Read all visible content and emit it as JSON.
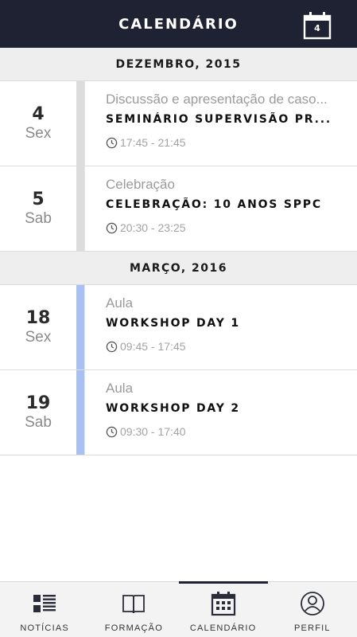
{
  "header": {
    "title": "CALENDÁRIO",
    "calendar_badge": "4"
  },
  "sections": [
    {
      "month": "DEZEMBRO, 2015",
      "events": [
        {
          "day": "4",
          "weekday": "Sex",
          "category": "Discussão e apresentação de caso...",
          "title": "SEMINÁRIO SUPERVISÃO PR...",
          "time": "17:45 - 21:45",
          "bar_color": "#dcdcdc"
        },
        {
          "day": "5",
          "weekday": "Sab",
          "category": "Celebração",
          "title": "CELEBRAÇÃO: 10 ANOS SPPC",
          "time": "20:30 - 23:25",
          "bar_color": "#dcdcdc"
        }
      ]
    },
    {
      "month": "MARÇO, 2016",
      "events": [
        {
          "day": "18",
          "weekday": "Sex",
          "category": "Aula",
          "title": "WORKSHOP DAY 1",
          "time": "09:45 - 17:45",
          "bar_color": "#a9c1f1"
        },
        {
          "day": "19",
          "weekday": "Sab",
          "category": "Aula",
          "title": "WORKSHOP DAY 2",
          "time": "09:30 - 17:40",
          "bar_color": "#a9c1f1"
        }
      ]
    }
  ],
  "tabs": [
    {
      "label": "NOTÍCIAS",
      "icon": "news-list-icon",
      "active": false
    },
    {
      "label": "FORMAÇÃO",
      "icon": "open-book-icon",
      "active": false
    },
    {
      "label": "CALENDÁRIO",
      "icon": "calendar-grid-icon",
      "active": true
    },
    {
      "label": "PERFIL",
      "icon": "user-profile-icon",
      "active": false
    }
  ]
}
